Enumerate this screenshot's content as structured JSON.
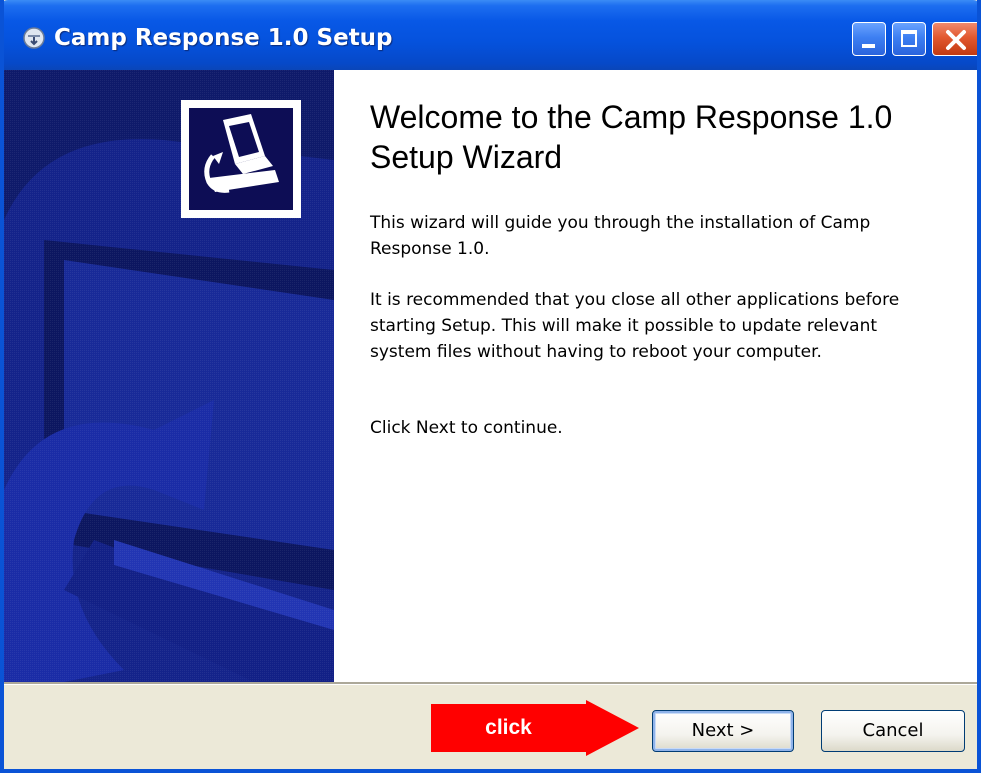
{
  "window": {
    "title": "Camp Response 1.0 Setup",
    "title_color": "#ffffff",
    "titlebar_color": "#0552dd"
  },
  "titlebar_buttons": {
    "minimize_icon": "minimize-icon",
    "maximize_icon": "maximize-icon",
    "close_icon": "close-icon"
  },
  "sidebar": {
    "background_color": "#0e1a6a",
    "logo_icon": "installer-computer-icon"
  },
  "content": {
    "heading": "Welcome to the Camp Response 1.0 Setup Wizard",
    "paragraphs": [
      "This wizard will guide you through the installation of Camp Response 1.0.",
      "It is recommended that you close all other applications before starting Setup. This will make it possible to update relevant system files without having to reboot your computer.",
      "Click Next to continue."
    ]
  },
  "annotation": {
    "label": "click",
    "color": "#ff0000"
  },
  "buttons": {
    "next": "Next >",
    "cancel": "Cancel"
  }
}
